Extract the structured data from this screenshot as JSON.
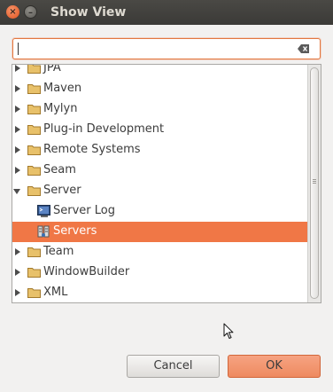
{
  "window": {
    "title": "Show View"
  },
  "filter": {
    "value": "",
    "placeholder": ""
  },
  "tree": {
    "items": [
      {
        "label": "JPA",
        "kind": "folder",
        "state": "collapsed"
      },
      {
        "label": "Maven",
        "kind": "folder",
        "state": "collapsed"
      },
      {
        "label": "Mylyn",
        "kind": "folder",
        "state": "collapsed"
      },
      {
        "label": "Plug-in Development",
        "kind": "folder",
        "state": "collapsed"
      },
      {
        "label": "Remote Systems",
        "kind": "folder",
        "state": "collapsed"
      },
      {
        "label": "Seam",
        "kind": "folder",
        "state": "collapsed"
      },
      {
        "label": "Server",
        "kind": "folder",
        "state": "expanded"
      },
      {
        "label": "Server Log",
        "kind": "view",
        "icon": "server-log-icon"
      },
      {
        "label": "Servers",
        "kind": "view",
        "icon": "servers-icon",
        "selected": true
      },
      {
        "label": "Team",
        "kind": "folder",
        "state": "collapsed"
      },
      {
        "label": "WindowBuilder",
        "kind": "folder",
        "state": "collapsed"
      },
      {
        "label": "XML",
        "kind": "folder",
        "state": "collapsed"
      }
    ]
  },
  "buttons": {
    "cancel": "Cancel",
    "ok": "OK"
  },
  "colors": {
    "accent": "#f07746",
    "titlebar": "#3b3a37",
    "folder": "#e8c16a"
  }
}
